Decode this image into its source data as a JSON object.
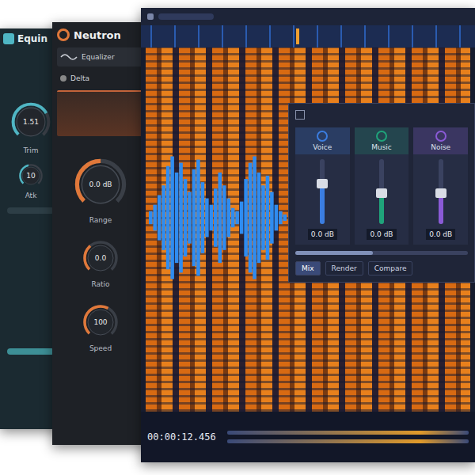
{
  "equinox": {
    "title": "Equin",
    "knob": {
      "label": "Trim",
      "value": "1.51",
      "level": 0.72
    },
    "small_knobs": [
      {
        "label": "Atk",
        "value": "10",
        "level": 0.45
      }
    ]
  },
  "neutron": {
    "title": "Neutron",
    "module": "Equalizer",
    "band": "Delta",
    "knobs": [
      {
        "label": "Range",
        "value": "0.0 dB",
        "level": 0.5
      },
      {
        "label": "Ratio",
        "value": "0.0",
        "level": 0.35
      },
      {
        "label": "Speed",
        "value": "100",
        "level": 0.6
      }
    ]
  },
  "rx": {
    "time": "00:00:12.456",
    "waveform": [
      0.1,
      0.2,
      0.35,
      0.5,
      0.8,
      0.95,
      0.7,
      0.85,
      0.6,
      0.4,
      0.75,
      0.9,
      0.55,
      0.3,
      0.2,
      0.45,
      0.7,
      0.5,
      0.3,
      0.15,
      0.1,
      0.25,
      0.6,
      0.85,
      0.95,
      0.7,
      0.5,
      0.65,
      0.4,
      0.2,
      0.1,
      0.05
    ]
  },
  "panel": {
    "channels": [
      {
        "name": "Voice",
        "level": 0.62,
        "reading": "0.0 dB",
        "color": "#3b7de0"
      },
      {
        "name": "Music",
        "level": 0.48,
        "reading": "0.0 dB",
        "color": "#1fa37a"
      },
      {
        "name": "Noise",
        "level": 0.48,
        "reading": "0.0 dB",
        "color": "#8a5ad6"
      }
    ],
    "amount": {
      "level": 0.45
    },
    "buttons": [
      {
        "label": "Mix",
        "selected": true
      },
      {
        "label": "Render",
        "selected": false
      },
      {
        "label": "Compare",
        "selected": false
      }
    ]
  }
}
